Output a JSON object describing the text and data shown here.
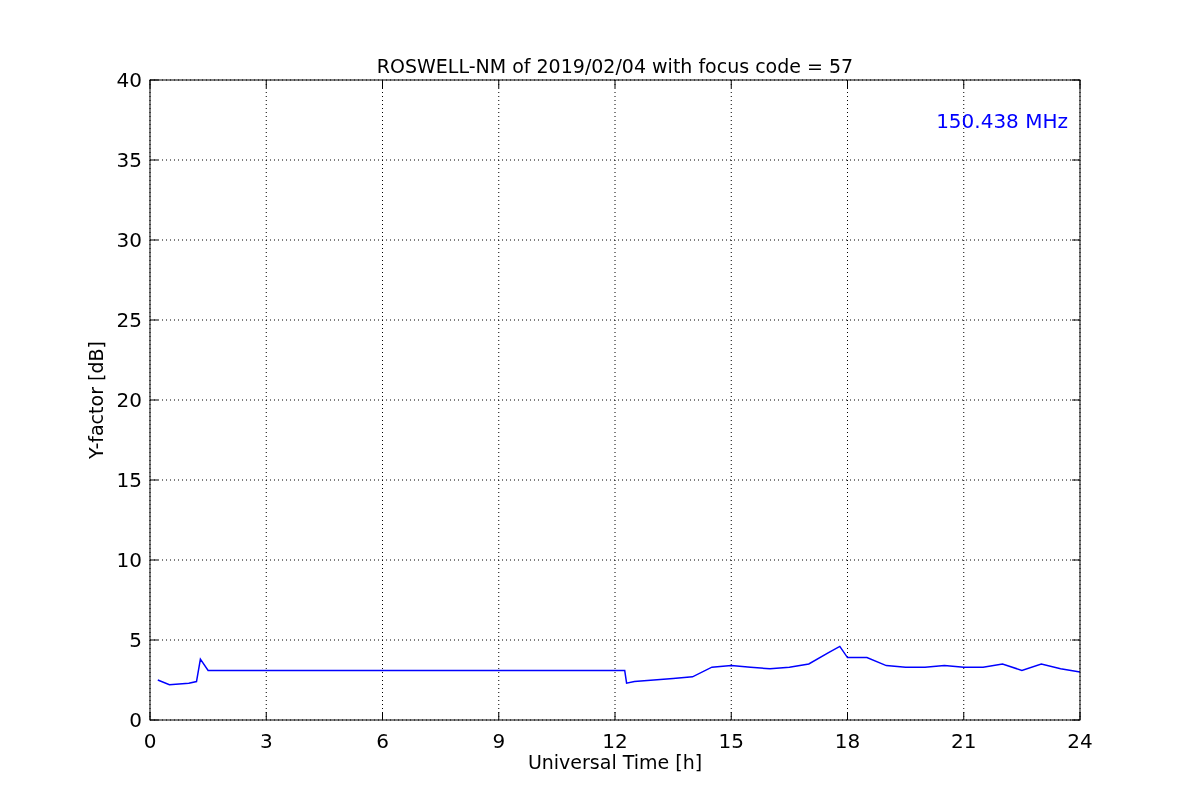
{
  "chart_data": {
    "type": "line",
    "title": "ROSWELL-NM of 2019/02/04 with focus code = 57",
    "xlabel": "Universal Time [h]",
    "ylabel": "Y-factor [dB]",
    "x": [
      0.2,
      0.5,
      1.0,
      1.2,
      1.3,
      1.5,
      12.25,
      12.3,
      12.5,
      13,
      13.5,
      14,
      14.5,
      15,
      15.5,
      16,
      16.5,
      17,
      17.5,
      17.8,
      18,
      18.5,
      19,
      19.5,
      20,
      20.5,
      21,
      21.5,
      22,
      22.5,
      23,
      23.5,
      24
    ],
    "series": [
      {
        "name": "150.438 MHz",
        "color": "#0000ff",
        "values": [
          2.5,
          2.2,
          2.3,
          2.4,
          3.8,
          3.1,
          3.1,
          2.3,
          2.4,
          2.5,
          2.6,
          2.7,
          3.3,
          3.4,
          3.3,
          3.2,
          3.3,
          3.5,
          4.2,
          4.6,
          3.9,
          3.9,
          3.4,
          3.3,
          3.3,
          3.4,
          3.3,
          3.3,
          3.5,
          3.1,
          3.5,
          3.2,
          3.0
        ]
      }
    ],
    "xlim": [
      0,
      24
    ],
    "ylim": [
      0,
      40
    ],
    "xticks": [
      0,
      3,
      6,
      9,
      12,
      15,
      18,
      21,
      24
    ],
    "yticks": [
      0,
      5,
      10,
      15,
      20,
      25,
      30,
      35,
      40
    ],
    "grid": true
  }
}
